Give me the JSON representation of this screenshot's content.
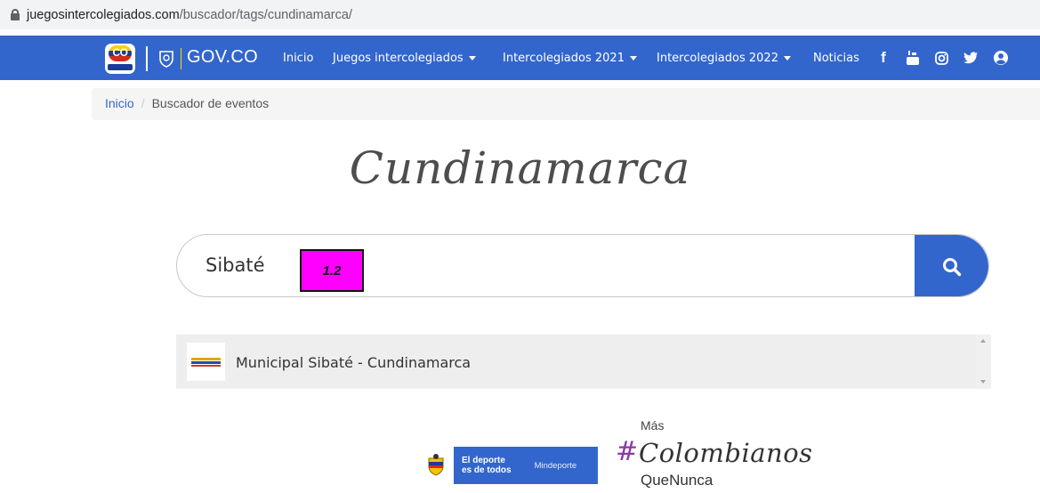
{
  "browser": {
    "url_domain": "juegosintercolegiados.com",
    "url_path": "/buscador/tags/cundinamarca/"
  },
  "nav": {
    "logo_text": "CO",
    "govco": "GOV.CO",
    "items": [
      {
        "label": "Inicio",
        "dropdown": false
      },
      {
        "label": "Juegos intercolegiados",
        "dropdown": true
      },
      {
        "label": "Intercolegiados 2021",
        "dropdown": true
      },
      {
        "label": "Intercolegiados 2022",
        "dropdown": true
      },
      {
        "label": "Noticias",
        "dropdown": false
      }
    ],
    "social": [
      "facebook-icon",
      "youtube-icon",
      "instagram-icon",
      "twitter-icon",
      "user-icon"
    ]
  },
  "breadcrumb": {
    "home": "Inicio",
    "separator": "/",
    "current": "Buscador de eventos"
  },
  "page": {
    "title": "Cundinamarca"
  },
  "search": {
    "value": "Sibaté",
    "button_icon": "search-icon"
  },
  "annotation": {
    "label": "1.2",
    "color": "#ff00ff"
  },
  "results": [
    {
      "label": "Municipal Sibaté - Cundinamarca"
    }
  ],
  "footer": {
    "deporte_line1": "El deporte",
    "deporte_line2": "es de todos",
    "ministry": "Mindeporte",
    "campaign_top": "Más",
    "campaign_hash": "#",
    "campaign_main": "Colombianos",
    "campaign_bottom": "QueNunca"
  },
  "colors": {
    "nav": "#3366cc",
    "accent": "#3366cc"
  }
}
